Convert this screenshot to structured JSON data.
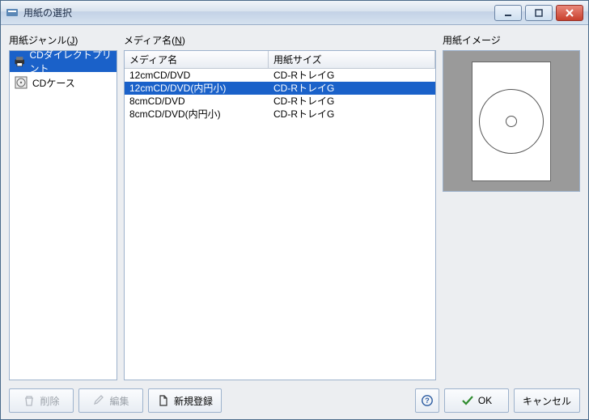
{
  "window": {
    "title": "用紙の選択"
  },
  "labels": {
    "genre": "用紙ジャンル(J)",
    "media": "メディア名(N)",
    "preview": "用紙イメージ"
  },
  "genre": {
    "items": [
      {
        "label": "CDダイレクトプリント",
        "icon": "printer-icon",
        "selected": true
      },
      {
        "label": "CDケース",
        "icon": "cdcase-icon",
        "selected": false
      }
    ]
  },
  "media_table": {
    "columns": {
      "media": "メディア名",
      "size": "用紙サイズ"
    },
    "rows": [
      {
        "media": "12cmCD/DVD",
        "size": "CD-RトレイG",
        "selected": false
      },
      {
        "media": "12cmCD/DVD(内円小)",
        "size": "CD-RトレイG",
        "selected": true
      },
      {
        "media": "8cmCD/DVD",
        "size": "CD-RトレイG",
        "selected": false
      },
      {
        "media": "8cmCD/DVD(内円小)",
        "size": "CD-RトレイG",
        "selected": false
      }
    ]
  },
  "buttons": {
    "delete": "削除",
    "edit": "編集",
    "new": "新規登録",
    "ok": "OK",
    "cancel": "キャンセル"
  }
}
